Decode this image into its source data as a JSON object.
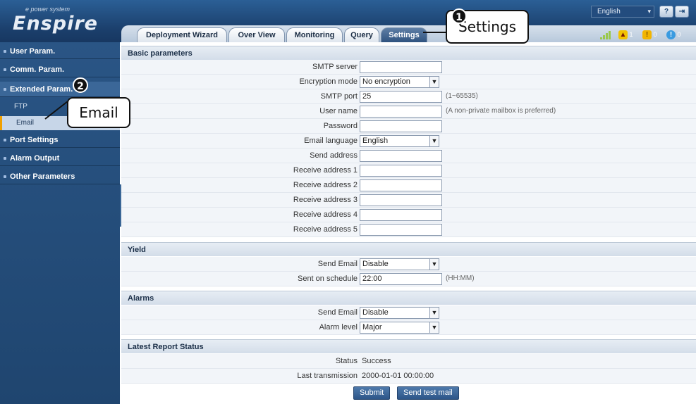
{
  "header": {
    "brand": "Enspire",
    "brand_sub": "e power system",
    "language": "English",
    "help_icon": "help-icon",
    "logout_icon": "logout-icon",
    "tabs": [
      {
        "label": "Deployment Wizard"
      },
      {
        "label": "Over View"
      },
      {
        "label": "Monitoring"
      },
      {
        "label": "Query"
      },
      {
        "label": "Settings"
      }
    ],
    "alarms": {
      "major_count": "1",
      "minor_count": "0",
      "warning_count": "0"
    }
  },
  "sidebar": {
    "items": [
      {
        "label": "User Param."
      },
      {
        "label": "Comm. Param."
      },
      {
        "label": "Extended Param."
      },
      {
        "label": "FTP"
      },
      {
        "label": "Email"
      },
      {
        "label": "Port Settings"
      },
      {
        "label": "Alarm Output"
      },
      {
        "label": "Other Parameters"
      }
    ]
  },
  "basic": {
    "title": "Basic parameters",
    "smtp_server_label": "SMTP server",
    "smtp_server_value": "",
    "encryption_label": "Encryption mode",
    "encryption_value": "No encryption",
    "smtp_port_label": "SMTP port",
    "smtp_port_value": "25",
    "smtp_port_hint": "(1~65535)",
    "user_name_label": "User name",
    "user_name_value": "",
    "user_name_hint": "(A non-private mailbox is preferred)",
    "password_label": "Password",
    "email_language_label": "Email language",
    "email_language_value": "English",
    "send_address_label": "Send address",
    "receive_1_label": "Receive address 1",
    "receive_2_label": "Receive address 2",
    "receive_3_label": "Receive address 3",
    "receive_4_label": "Receive address 4",
    "receive_5_label": "Receive address 5"
  },
  "yield": {
    "title": "Yield",
    "send_email_label": "Send Email",
    "send_email_value": "Disable",
    "schedule_label": "Sent on schedule",
    "schedule_value": "22:00",
    "schedule_hint": "(HH:MM)"
  },
  "alarms": {
    "title": "Alarms",
    "send_email_label": "Send Email",
    "send_email_value": "Disable",
    "level_label": "Alarm level",
    "level_value": "Major"
  },
  "report": {
    "title": "Latest Report Status",
    "status_label": "Status",
    "status_value": "Success",
    "last_label": "Last transmission",
    "last_value": "2000-01-01 00:00:00"
  },
  "actions": {
    "submit": "Submit",
    "test": "Send test mail"
  },
  "callouts": {
    "step1_number": "1",
    "step1_text": "Settings",
    "step2_number": "2",
    "step2_text": "Email"
  }
}
